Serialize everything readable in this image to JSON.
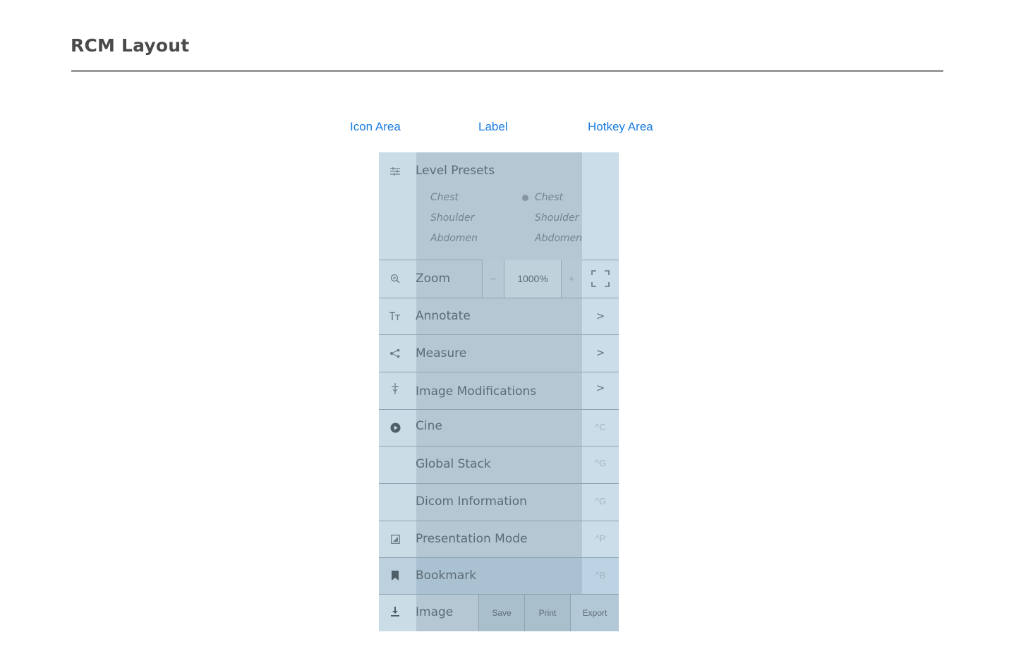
{
  "page_title": "RCM Layout",
  "area_labels": {
    "icon_area": "Icon Area",
    "label": "Label",
    "hotkey_area": "Hotkey Area"
  },
  "menu": {
    "level_presets": {
      "label": "Level Presets",
      "icon": "sliders-icon",
      "column_a": [
        "Chest",
        "Shoulder",
        "Abdomen"
      ],
      "column_b": [
        "Chest",
        "Shoulder",
        "Abdomen"
      ]
    },
    "zoom": {
      "label": "Zoom",
      "icon": "zoom-icon",
      "minus": "−",
      "value": "1000%",
      "plus": "+",
      "hotkey_icon": "fullscreen-icon"
    },
    "annotate": {
      "label": "Annotate",
      "icon": "text-size-icon",
      "chevron": ">"
    },
    "measure": {
      "label": "Measure",
      "icon": "measure-icon",
      "chevron": ">"
    },
    "image_modifications": {
      "label": "Image Modifications",
      "icon": "image-modifications-icon",
      "chevron": ">"
    },
    "cine": {
      "label": "Cine",
      "icon": "play-circle-icon",
      "hotkey": "^C"
    },
    "global_stack": {
      "label": "Global Stack",
      "hotkey": "^G"
    },
    "dicom_information": {
      "label": "Dicom Information",
      "hotkey": "^G"
    },
    "presentation_mode": {
      "label": "Presentation Mode",
      "icon": "presentation-icon",
      "hotkey": "^P"
    },
    "bookmark": {
      "label": "Bookmark",
      "icon": "bookmark-icon",
      "hotkey": "^B"
    },
    "image": {
      "label": "Image",
      "icon": "download-icon",
      "save": "Save",
      "print": "Print",
      "export": "Export"
    }
  },
  "colors": {
    "accent_blue": "#1a7de0",
    "title_gray": "#4a4a4a"
  }
}
